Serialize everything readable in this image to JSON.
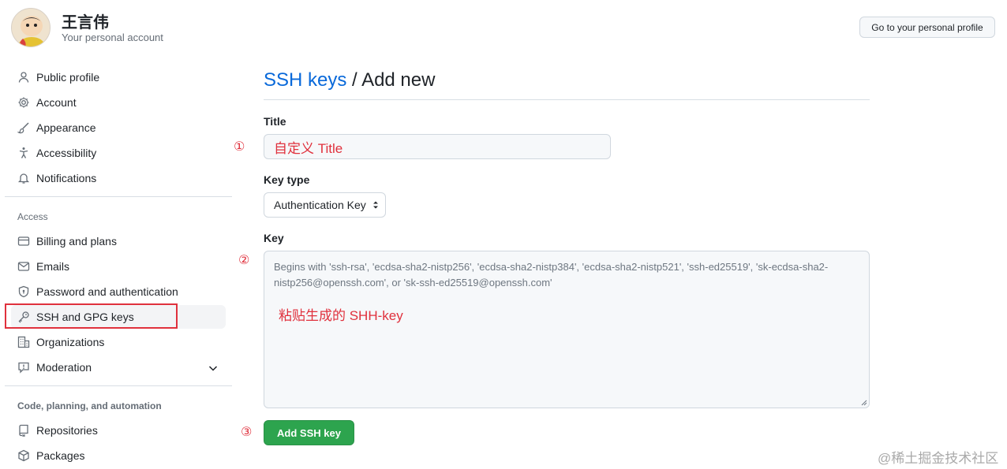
{
  "user": {
    "name": "王言伟",
    "subtitle": "Your personal account",
    "profile_button": "Go to your personal profile"
  },
  "sidebar": {
    "top_items": [
      {
        "label": "Public profile",
        "icon": "person-icon"
      },
      {
        "label": "Account",
        "icon": "gear-icon"
      },
      {
        "label": "Appearance",
        "icon": "paintbrush-icon"
      },
      {
        "label": "Accessibility",
        "icon": "accessibility-icon"
      },
      {
        "label": "Notifications",
        "icon": "bell-icon"
      }
    ],
    "access_heading": "Access",
    "access_items": [
      {
        "label": "Billing and plans",
        "icon": "credit-card-icon"
      },
      {
        "label": "Emails",
        "icon": "mail-icon"
      },
      {
        "label": "Password and authentication",
        "icon": "shield-lock-icon"
      },
      {
        "label": "SSH and GPG keys",
        "icon": "key-icon",
        "active": true
      },
      {
        "label": "Organizations",
        "icon": "organization-icon"
      },
      {
        "label": "Moderation",
        "icon": "report-icon"
      }
    ],
    "code_heading": "Code, planning, and automation",
    "code_items": [
      {
        "label": "Repositories",
        "icon": "repo-icon"
      },
      {
        "label": "Packages",
        "icon": "package-icon"
      }
    ]
  },
  "main": {
    "breadcrumb_link": "SSH keys",
    "breadcrumb_separator": " / ",
    "breadcrumb_current": "Add new",
    "title_label": "Title",
    "title_value": "自定义 Title",
    "key_type_label": "Key type",
    "key_type_value": "Authentication Key",
    "key_label": "Key",
    "key_placeholder": "Begins with 'ssh-rsa', 'ecdsa-sha2-nistp256', 'ecdsa-sha2-nistp384', 'ecdsa-sha2-nistp521', 'ssh-ed25519', 'sk-ecdsa-sha2-nistp256@openssh.com', or 'sk-ssh-ed25519@openssh.com'",
    "key_annotation": "粘贴生成的 SHH-key",
    "add_button": "Add SSH key",
    "step_marks": [
      "①",
      "②",
      "③"
    ]
  },
  "colors": {
    "accent_link": "#0969da",
    "annotation_red": "#e0313d",
    "primary_button": "#2da44e"
  },
  "watermark": "@稀土掘金技术社区"
}
